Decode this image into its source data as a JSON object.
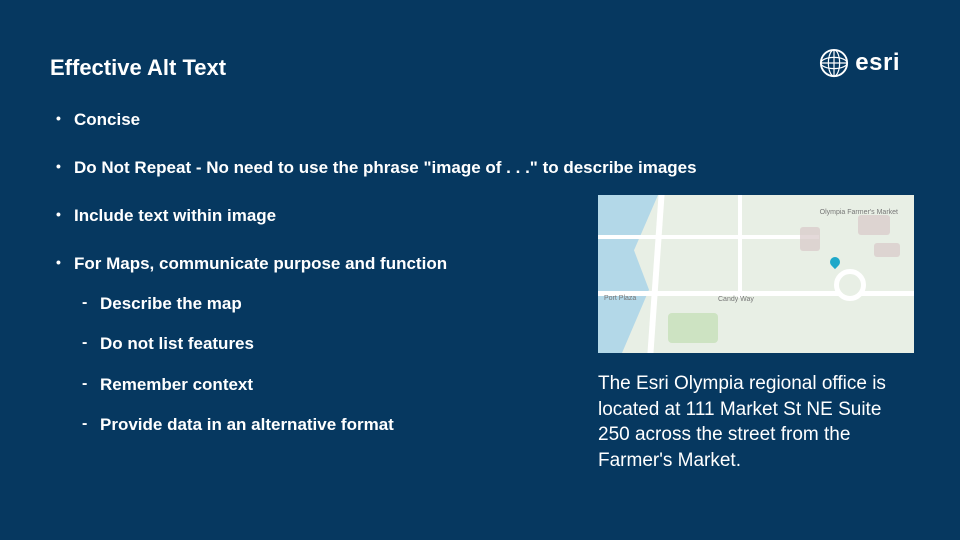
{
  "title": "Effective Alt Text",
  "logo": {
    "name": "esri"
  },
  "bullets": {
    "b1": "Concise",
    "b2": "Do Not Repeat - No need to use the phrase \"image of . . .\" to describe images",
    "b3": "Include text within image",
    "b4": "For Maps, communicate purpose and function",
    "sub": {
      "s1": "Describe the map",
      "s2": "Do not list features",
      "s3": "Remember context",
      "s4": "Provide data in an alternative format"
    }
  },
  "map": {
    "labels": {
      "port": "Port Plaza",
      "farmers": "Olympia Farmer's Market",
      "candy": "Candy Way"
    },
    "caption": "The Esri Olympia regional office is located at 111 Market St NE Suite 250 across the street from the Farmer's Market."
  }
}
